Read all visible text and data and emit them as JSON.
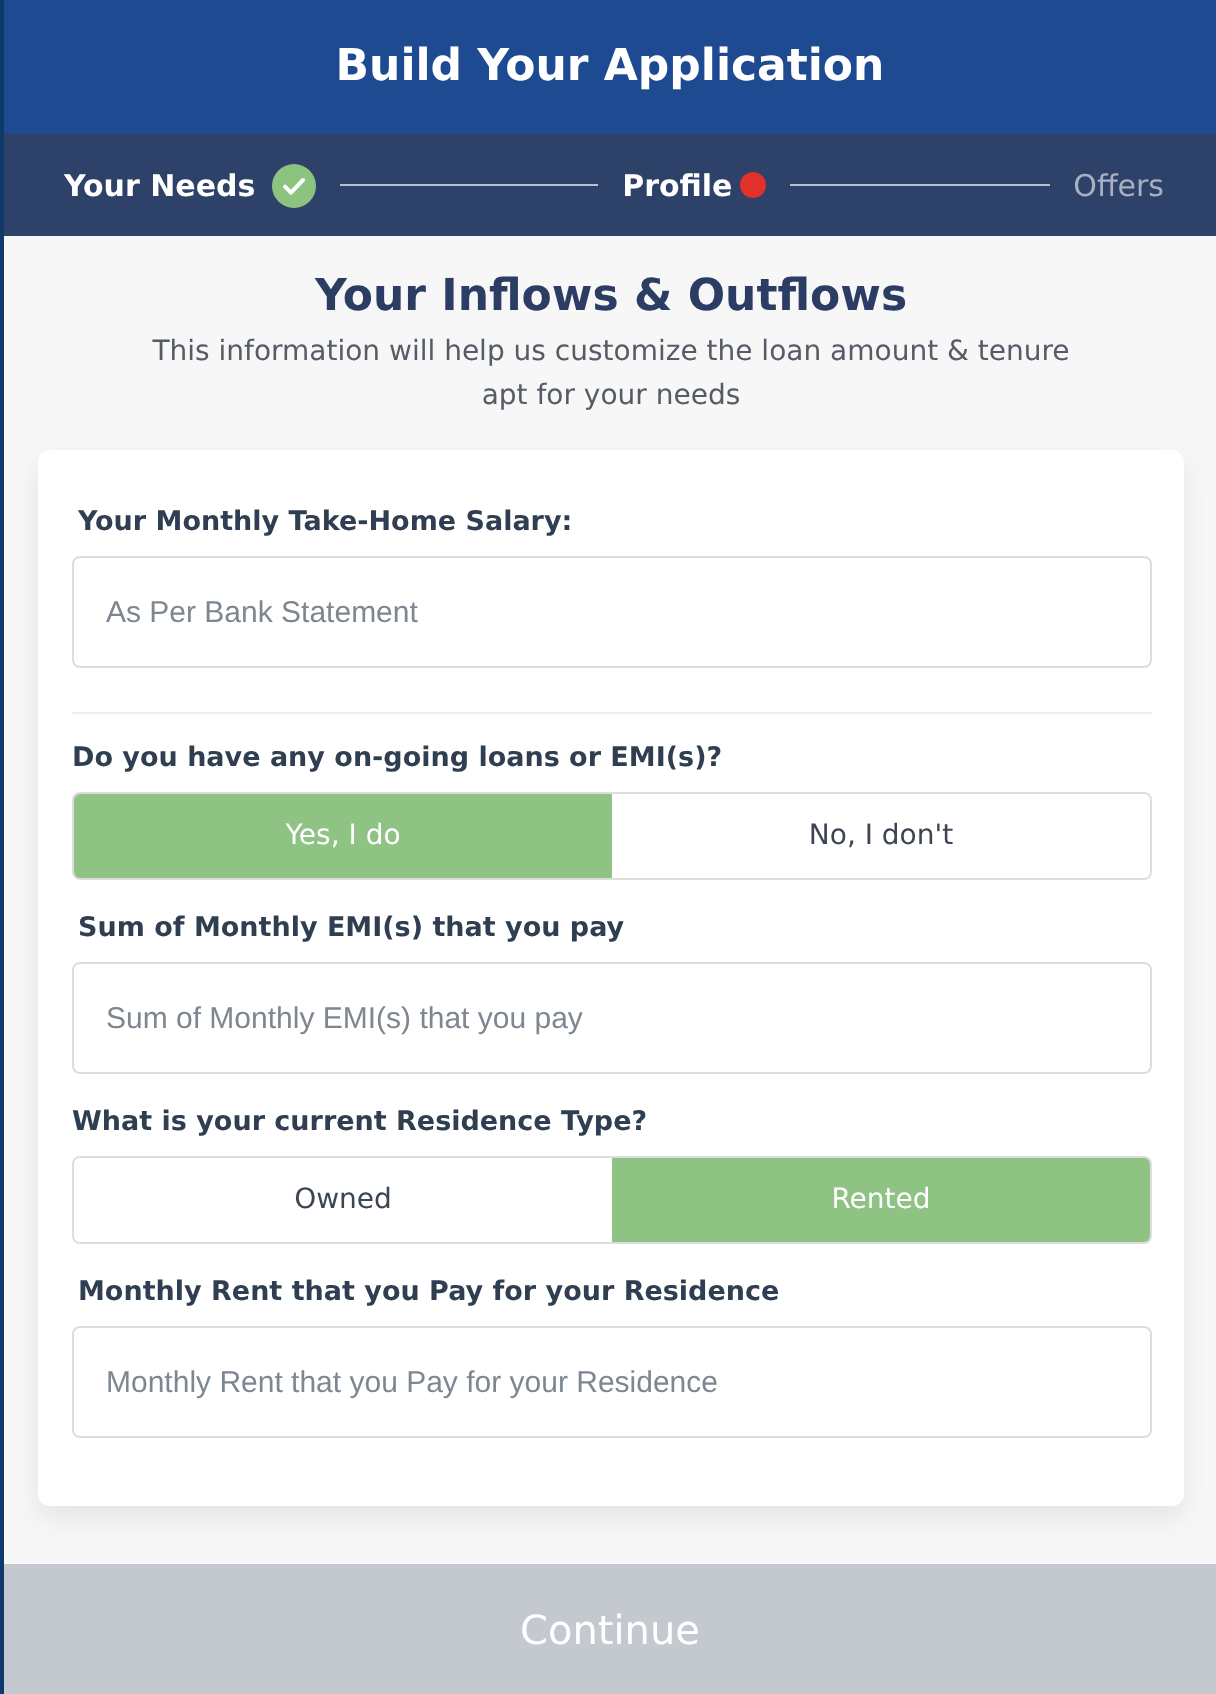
{
  "header": {
    "title": "Build Your Application"
  },
  "steps": [
    {
      "label": "Your Needs",
      "done": true,
      "current": false
    },
    {
      "label": "Profile",
      "done": false,
      "current": true
    },
    {
      "label": "Offers",
      "done": false,
      "current": false
    }
  ],
  "section": {
    "title": "Your Inflows & Outflows",
    "subtitle": "This information will help us customize the loan amount & tenure apt for your needs"
  },
  "form": [
    {
      "kind": "input",
      "label": "Your Monthly Take-Home Salary:",
      "placeholder": "As Per Bank Statement"
    },
    {
      "kind": "divider"
    },
    {
      "kind": "choice",
      "label": "Do you have any on-going loans or EMI(s)?",
      "options": [
        {
          "label": "Yes, I do",
          "selected": true
        },
        {
          "label": "No, I don't",
          "selected": false
        }
      ]
    },
    {
      "kind": "input",
      "label": "Sum of Monthly EMI(s) that you pay",
      "placeholder": "Sum of Monthly EMI(s) that you pay"
    },
    {
      "kind": "choice",
      "label": "What is your current Residence Type?",
      "options": [
        {
          "label": "Owned",
          "selected": false
        },
        {
          "label": "Rented",
          "selected": true
        }
      ]
    },
    {
      "kind": "input",
      "label": "Monthly Rent that you Pay for your Residence",
      "placeholder": "Monthly Rent that you Pay for your Residence"
    }
  ],
  "continue": {
    "label": "Continue",
    "disabled": true
  }
}
